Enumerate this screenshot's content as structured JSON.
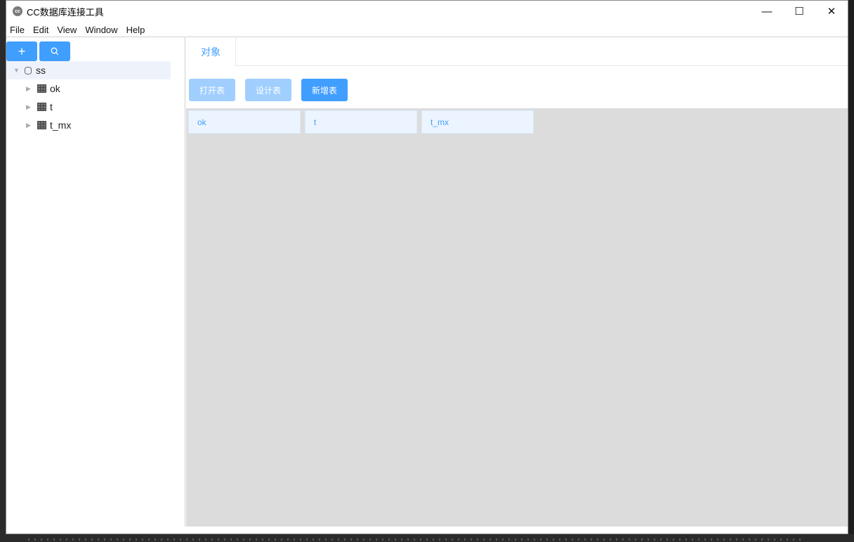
{
  "window": {
    "app_icon_text": "cc",
    "title": "CC数据库连接工具",
    "controls": {
      "minimize": "—",
      "maximize": "☐",
      "close": "✕"
    }
  },
  "menu": [
    "File",
    "Edit",
    "View",
    "Window",
    "Help"
  ],
  "sidebar": {
    "add_icon": "+",
    "search_icon": "⚲",
    "tree": {
      "root": {
        "label": "ss",
        "expanded": true
      },
      "children": [
        {
          "label": "ok"
        },
        {
          "label": "t"
        },
        {
          "label": "t_mx"
        }
      ]
    }
  },
  "main": {
    "tab_label": "对象",
    "buttons": {
      "open_table": "打开表",
      "design_table": "设计表",
      "new_table": "新增表"
    },
    "objects": [
      "ok",
      "t",
      "t_mx"
    ]
  },
  "colors": {
    "accent": "#409eff",
    "accent_light": "#a0cfff",
    "card_bg": "#ecf5ff",
    "object_area_bg": "#dcdcdc"
  }
}
